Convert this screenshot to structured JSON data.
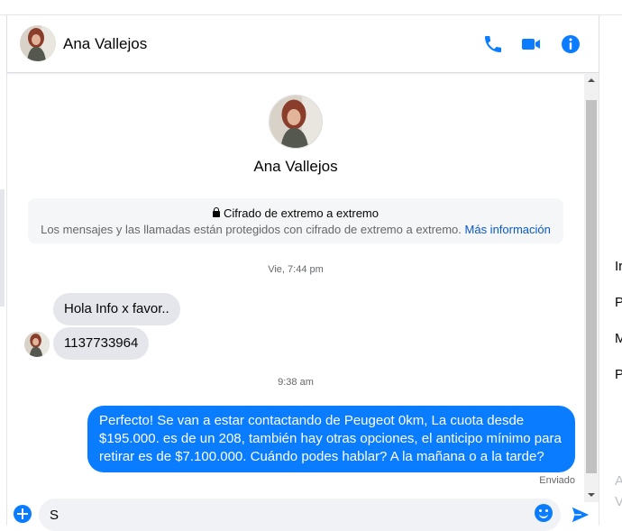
{
  "contact": {
    "name": "Ana Vallejos"
  },
  "header": {
    "call_icon": "phone-icon",
    "video_icon": "video-camera-icon",
    "info_icon": "info-icon"
  },
  "encryption": {
    "title": "Cifrado de extremo a extremo",
    "body": "Los mensajes y las llamadas están protegidos con cifrado de extremo a extremo.",
    "link": "Más información"
  },
  "timestamps": [
    "Vie, 7:44 pm",
    "9:38 am"
  ],
  "messages": [
    {
      "direction": "incoming",
      "text": "Hola Info x favor.."
    },
    {
      "direction": "incoming",
      "text": "1137733964"
    },
    {
      "direction": "outgoing",
      "text": "Perfecto!  Se van a estar contactando de Peugeot 0km, La cuota desde $195.000. es de un 208, también hay otras opciones, el anticipo mínimo para retirar es de $7.100.000. Cuándo podes hablar? A la mañana o a la tarde?"
    }
  ],
  "status": {
    "sent": "Enviado"
  },
  "composer": {
    "value": "S"
  },
  "right_panel": {
    "letters": [
      "Ir",
      "P",
      "M",
      "P",
      "A",
      "V"
    ]
  },
  "colors": {
    "accent": "#0a7cff",
    "bubble_in": "#e4e6eb"
  }
}
